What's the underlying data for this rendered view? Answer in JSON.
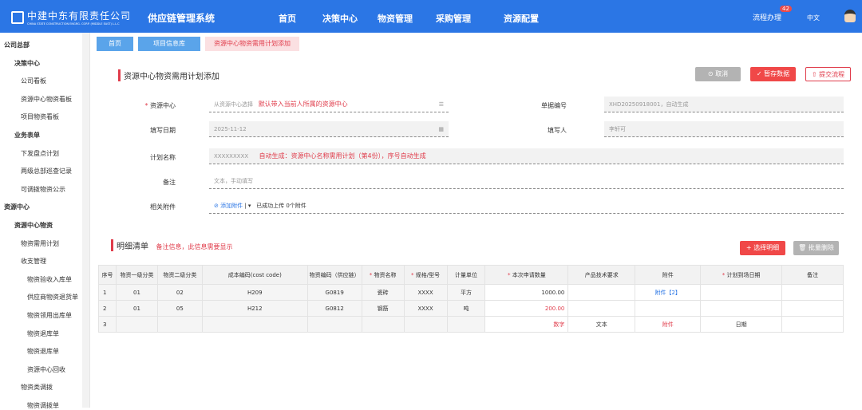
{
  "header": {
    "company_cn": "中建中东有限责任公司",
    "company_en": "CHINA STATE CONSTRUCTION ENGRG. CORP. (MIDDLE EAST) L.L.C",
    "system": "供应链管理系统",
    "nav": [
      "首页",
      "决策中心",
      "物资管理",
      "采购管理",
      "资源配置"
    ],
    "flow": "流程办理",
    "flow_badge": "42",
    "lang": "中文"
  },
  "sidebar": {
    "items": [
      {
        "label": "公司总部",
        "level": 0
      },
      {
        "label": "决策中心",
        "level": 1
      },
      {
        "label": "公司看板",
        "level": 2
      },
      {
        "label": "资源中心物资看板",
        "level": 2
      },
      {
        "label": "项目物资看板",
        "level": 2
      },
      {
        "label": "业务表单",
        "level": 1
      },
      {
        "label": "下发盘点计划",
        "level": 2
      },
      {
        "label": "两级总部巡查记录",
        "level": 2
      },
      {
        "label": "可调拨物资公示",
        "level": 2
      },
      {
        "label": "资源中心",
        "level": 0
      },
      {
        "label": "资源中心物资",
        "level": 1
      },
      {
        "label": "物资需用计划",
        "level": 2
      },
      {
        "label": "收支管理",
        "level": 2
      },
      {
        "label": "物资验收入库单",
        "level": 3
      },
      {
        "label": "供应商物资退货单",
        "level": 3
      },
      {
        "label": "物资领用出库单",
        "level": 3
      },
      {
        "label": "物资退库单",
        "level": 3
      },
      {
        "label": "物资退库单",
        "level": 3
      },
      {
        "label": "资源中心回收",
        "level": 3
      },
      {
        "label": "物资类调拨",
        "level": 2
      },
      {
        "label": "物资调拨单",
        "level": 3
      }
    ]
  },
  "tabs": [
    "首页",
    "项目信息库",
    "资源中心物资需用计划添加"
  ],
  "page": {
    "title": "资源中心物资需用计划添加",
    "cancel": "取消",
    "save": "暂存数据",
    "submit": "提交流程"
  },
  "form": {
    "center_label": "资源中心",
    "center_placeholder": "从资源中心选择",
    "center_note": "默认带入当前人所属的资源中心",
    "doc_no_label": "单据编号",
    "doc_no": "XHD20250918001，自动生成",
    "date_label": "填写日期",
    "date": "2025-11-12",
    "writer_label": "填写人",
    "writer": "李轩可",
    "plan_label": "计划名称",
    "plan": "XXXXXXXXX",
    "plan_note": "自动生成：资源中心名称需用计划（第4份），序号自动生成",
    "remark_label": "备注",
    "remark_placeholder": "文本，手动填写",
    "attach_label": "相关附件",
    "attach_btn": "添加附件",
    "attach_status": "已成功上传 0个附件"
  },
  "detail": {
    "title": "明细清单",
    "note": "备注信息，此信息需要显示",
    "select": "选择明细",
    "batch_delete": "批量删除",
    "columns": [
      "序号",
      "物资一级分类",
      "物资二级分类",
      "成本编码(cost code)",
      "物资编码（供应链）",
      "物资名称",
      "规格/型号",
      "计量单位",
      "本次申请数量",
      "产品技术要求",
      "附件",
      "计划到场日期",
      "备注"
    ],
    "required_columns": [
      5,
      6,
      8,
      11
    ],
    "rows": [
      [
        "1",
        "01",
        "02",
        "H209",
        "G0819",
        "瓷砖",
        "XXXX",
        "平方",
        "1000.00",
        "",
        "附件【2】",
        "",
        ""
      ],
      [
        "2",
        "01",
        "05",
        "H212",
        "G0812",
        "钢筋",
        "XXXX",
        "吨",
        "200.00",
        "",
        "",
        "",
        ""
      ],
      [
        "3",
        "",
        "",
        "",
        "",
        "",
        "",
        "",
        "数字",
        "文本",
        "附件",
        "日期",
        ""
      ]
    ]
  },
  "colors": {
    "header": "#2b76e5",
    "danger": "#f04848",
    "accent_red": "#e03c4b",
    "tab_blue": "#5aa4ea"
  }
}
